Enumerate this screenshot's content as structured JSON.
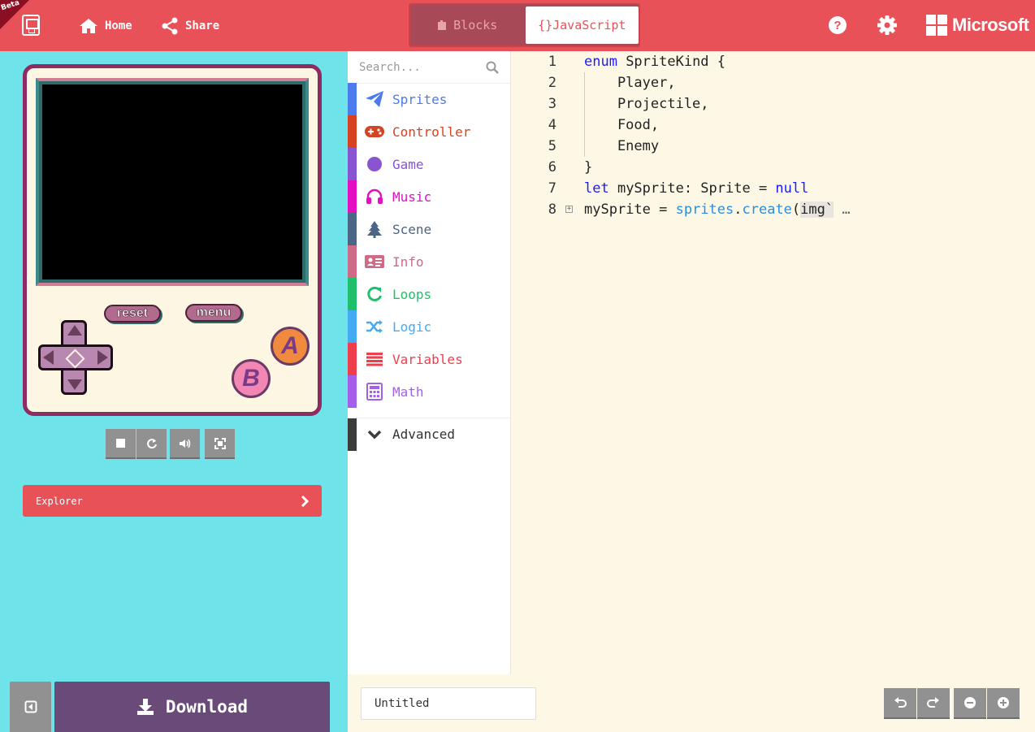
{
  "header": {
    "beta": "Beta",
    "home_label": "Home",
    "share_label": "Share",
    "blocks_label": "Blocks",
    "js_label": "{}JavaScript",
    "microsoft_label": "Microsoft"
  },
  "simulator": {
    "reset_label": "reset",
    "menu_label": "menu",
    "a_label": "A",
    "b_label": "B"
  },
  "explorer_label": "Explorer",
  "download_label": "Download",
  "toolbox": {
    "search_placeholder": "Search...",
    "categories": [
      {
        "label": "Sprites",
        "color": "#4b7bec",
        "icon": "paper-plane-icon"
      },
      {
        "label": "Controller",
        "color": "#d54322",
        "icon": "gamepad-icon"
      },
      {
        "label": "Game",
        "color": "#8854d0",
        "icon": "circle-icon"
      },
      {
        "label": "Music",
        "color": "#e30fc0",
        "icon": "headphones-icon"
      },
      {
        "label": "Scene",
        "color": "#4b6584",
        "icon": "tree-icon"
      },
      {
        "label": "Info",
        "color": "#cf6a87",
        "icon": "id-card-icon"
      },
      {
        "label": "Loops",
        "color": "#20bf6b",
        "icon": "refresh-icon"
      },
      {
        "label": "Logic",
        "color": "#45aaf2",
        "icon": "shuffle-icon"
      },
      {
        "label": "Variables",
        "color": "#ee3d4b",
        "icon": "list-icon"
      },
      {
        "label": "Math",
        "color": "#a55eea",
        "icon": "calculator-icon"
      }
    ],
    "advanced_label": "Advanced"
  },
  "editor": {
    "line_numbers": [
      "1",
      "2",
      "3",
      "4",
      "5",
      "6",
      "7",
      "8"
    ],
    "project_name": "Untitled"
  }
}
